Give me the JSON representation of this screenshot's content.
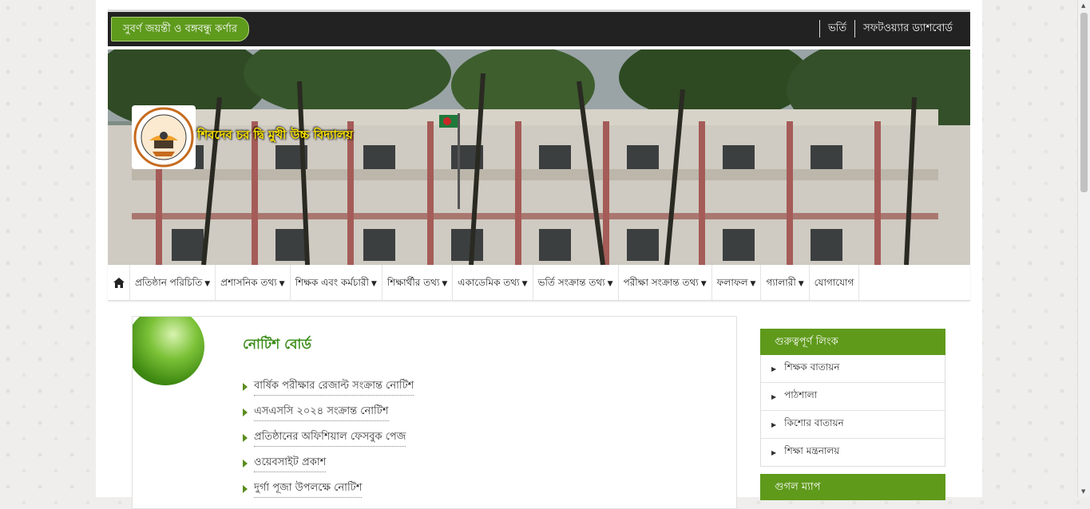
{
  "topbar": {
    "tag": "সুবর্ণ জয়ন্তী ও বঙ্গবন্ধু কর্ণার",
    "links": [
      "ভর্তি",
      "সফটওয়্যার ড্যাশবোর্ড"
    ]
  },
  "school": {
    "name": "শিবদেব চর দ্বি মুখী উচ্চ বিদ্যালয়"
  },
  "nav": {
    "items": [
      "প্রতিষ্ঠান পরিচিতি",
      "প্রশাসনিক তথ্য",
      "শিক্ষক এবং কর্মচারী",
      "শিক্ষার্থীর তথ্য",
      "একাডেমিক তথ্য",
      "ভর্তি সংক্রান্ত তথ্য",
      "পরীক্ষা সংক্রান্ত তথ্য",
      "ফলাফল",
      "গ্যালারী",
      "যোগাযোগ"
    ],
    "dropdown": [
      "true",
      "true",
      "true",
      "true",
      "true",
      "true",
      "true",
      "true",
      "true",
      "false"
    ]
  },
  "notice": {
    "title": "নোটিশ বোর্ড",
    "items": [
      "বার্ষিক পরীক্ষার রেজাল্ট সংক্রান্ত নোটিশ",
      "এসএসসি ২০২৪ সংক্রান্ত নোটিশ",
      "প্রতিষ্ঠানের অফিশিয়াল ফেসবুক পেজ",
      "ওয়েবসাইট প্রকাশ",
      "দুর্গা পূজা উপলক্ষে নোটিশ"
    ]
  },
  "sidebar": {
    "links_title": "গুরুত্বপূর্ণ লিংক",
    "links": [
      "শিক্ষক বাতায়ন",
      "পাঠশালা",
      "কিশোর বাতায়ন",
      "শিক্ষা মন্ত্রনালয়"
    ],
    "map_title": "গুগল ম্যাপ"
  },
  "colors": {
    "accent": "#5f9a1b",
    "topbar": "#222222",
    "title_yellow": "#ffe600"
  }
}
